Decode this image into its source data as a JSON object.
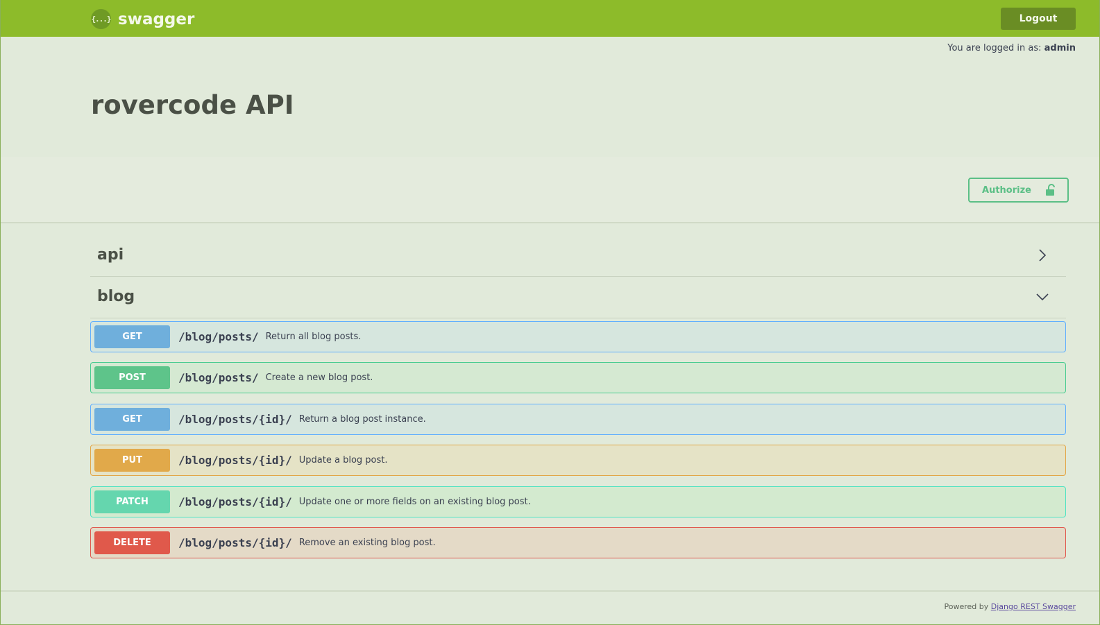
{
  "header": {
    "brand_logo_text": "{...}",
    "brand_name": "swagger",
    "logout_label": "Logout"
  },
  "session": {
    "prefix": "You are logged in as:",
    "username": "admin"
  },
  "api": {
    "title": "rovercode API"
  },
  "auth": {
    "authorize_label": "Authorize"
  },
  "tags": [
    {
      "name": "api",
      "expanded": false
    },
    {
      "name": "blog",
      "expanded": true
    }
  ],
  "operations": [
    {
      "method": "GET",
      "path": "/blog/posts/",
      "summary": "Return all blog posts."
    },
    {
      "method": "POST",
      "path": "/blog/posts/",
      "summary": "Create a new blog post."
    },
    {
      "method": "GET",
      "path": "/blog/posts/{id}/",
      "summary": "Return a blog post instance."
    },
    {
      "method": "PUT",
      "path": "/blog/posts/{id}/",
      "summary": "Update a blog post."
    },
    {
      "method": "PATCH",
      "path": "/blog/posts/{id}/",
      "summary": "Update one or more fields on an existing blog post."
    },
    {
      "method": "DELETE",
      "path": "/blog/posts/{id}/",
      "summary": "Remove an existing blog post."
    }
  ],
  "footer": {
    "prefix": "Powered by",
    "link_text": "Django REST Swagger"
  },
  "colors": {
    "topbar": "#8dbb2a",
    "get": "#61affe",
    "post": "#49cc90",
    "put": "#fca130",
    "patch": "#50e3c2",
    "delete": "#f93e3e",
    "authorize": "#49cc90"
  }
}
